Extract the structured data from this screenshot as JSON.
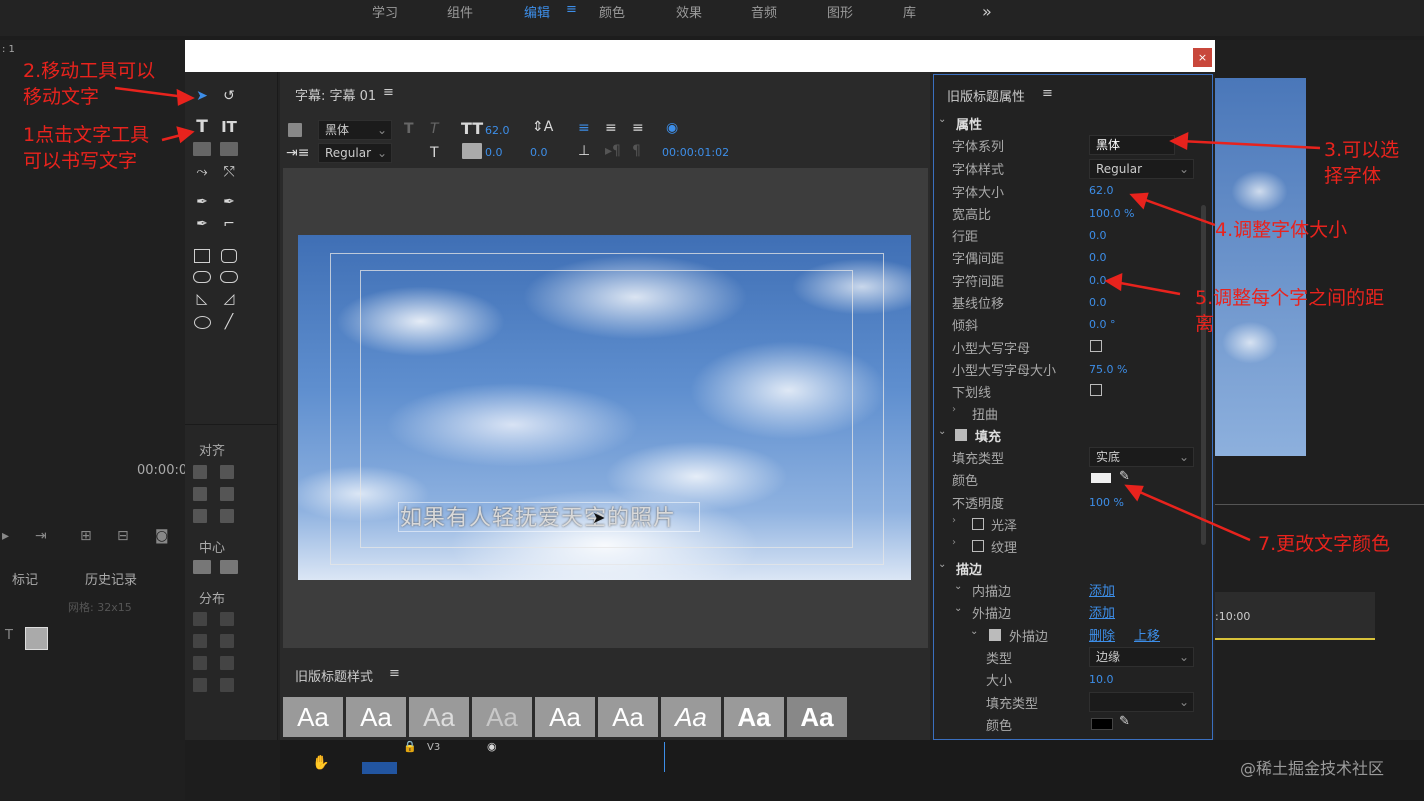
{
  "top_tabs": [
    "学习",
    "组件",
    "编辑",
    "颜色",
    "效果",
    "音频",
    "图形",
    "库"
  ],
  "top_tab_active": "编辑",
  "top_more": "»",
  "menu_icon": "≡",
  "close_label": "×",
  "caption_panel": {
    "title": "字幕: 字幕 01",
    "font_family": "黑体",
    "font_style": "Regular",
    "font_size": "62.0",
    "kerning": "0.0",
    "tracking": "0.0",
    "timecode": "00:00:01:02"
  },
  "canvas_text": "如果有人轻抚爱天空的照片",
  "tool_sections": {
    "align": "对齐",
    "center": "中心",
    "distribute": "分布"
  },
  "styles_panel": {
    "title": "旧版标题样式",
    "samples": [
      "Aa",
      "Aa",
      "Aa",
      "Aa",
      "Aa",
      "Aa",
      "Aa",
      "Aa",
      "Aa"
    ]
  },
  "props_panel": {
    "title": "旧版标题属性",
    "section_properties": "属性",
    "rows": [
      {
        "label": "字体系列",
        "value": "黑体"
      },
      {
        "label": "字体样式",
        "value": "Regular"
      },
      {
        "label": "字体大小",
        "value": "62.0"
      },
      {
        "label": "宽高比",
        "value": "100.0 %"
      },
      {
        "label": "行距",
        "value": "0.0"
      },
      {
        "label": "字偶间距",
        "value": "0.0"
      },
      {
        "label": "字符间距",
        "value": "0.0"
      },
      {
        "label": "基线位移",
        "value": "0.0"
      },
      {
        "label": "倾斜",
        "value": "0.0 °"
      },
      {
        "label": "小型大写字母",
        "value": ""
      },
      {
        "label": "小型大写字母大小",
        "value": "75.0 %"
      },
      {
        "label": "下划线",
        "value": ""
      }
    ],
    "distort": "扭曲",
    "fill": "填充",
    "fill_type_label": "填充类型",
    "fill_type_value": "实底",
    "color_label": "颜色",
    "opacity_label": "不透明度",
    "opacity_value": "100 %",
    "gloss": "光泽",
    "texture": "纹理",
    "stroke": "描边",
    "inner_stroke": "内描边",
    "outer_stroke": "外描边",
    "add": "添加",
    "outer_stroke_item": "外描边",
    "delete": "删除",
    "move_up": "上移",
    "type_label": "类型",
    "type_value": "边缘",
    "size_label": "大小",
    "size_value": "10.0",
    "fill_type2_label": "填充类型",
    "color2_label": "颜色"
  },
  "annotations": {
    "a1": "2.移动工具可以\n移动文字",
    "a2": "1点击文字工具\n可以书写文字",
    "a3": "3.可以选\n择字体",
    "a4": "4.调整字体大小",
    "a5": "5.调整每个字之间的距\n离",
    "a7": "7.更改文字颜色"
  },
  "background": {
    "timecode_left": "00:00:0",
    "marker_tab": "标记",
    "history_tab": "历史记录",
    "grid_label": "网格: 32x15",
    "timeline_time": ":10:00",
    "track_label": "V3",
    "top_left_label": ": 1"
  },
  "watermark": "@稀土掘金技术社区",
  "colors": {
    "accent": "#3d8ee8",
    "annotation": "#e8231d"
  }
}
